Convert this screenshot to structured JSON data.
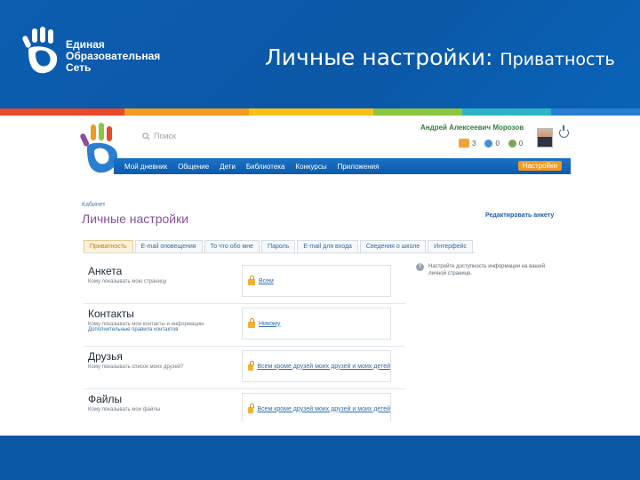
{
  "slide": {
    "title_main": "Личные настройки:",
    "title_sub": "Приватность",
    "logo_lines": [
      "Единая",
      "Образовательная",
      "Сеть"
    ]
  },
  "app": {
    "search_placeholder": "Поиск",
    "user_name": "Андрей Алексеевич Морозов",
    "counters": [
      {
        "icon": "messages-icon",
        "value": "3",
        "color": "#f2a23a"
      },
      {
        "icon": "friends-icon",
        "value": "0",
        "color": "#4a8fd4"
      },
      {
        "icon": "groups-icon",
        "value": "0",
        "color": "#7aa65a"
      }
    ],
    "nav_items": [
      "Мой дневник",
      "Общение",
      "Дети",
      "Библиотека",
      "Конкурсы",
      "Приложения"
    ],
    "nav_settings": "Настройки",
    "breadcrumb": "Кабинет",
    "page_title": "Личные настройки",
    "edit_link": "Редактировать анкету",
    "tabs": [
      {
        "label": "Приватность",
        "active": true
      },
      {
        "label": "E-mail оповещения",
        "active": false
      },
      {
        "label": "То что обо мне",
        "active": false
      },
      {
        "label": "Пароль",
        "active": false
      },
      {
        "label": "E-mail для входа",
        "active": false
      },
      {
        "label": "Сведения о школе",
        "active": false
      },
      {
        "label": "Интерфейс",
        "active": false
      }
    ],
    "settings": [
      {
        "title": "Анкета",
        "desc": "Кому показывать мою страницу",
        "link": "",
        "value": "Всем"
      },
      {
        "title": "Контакты",
        "desc": "Кому показывать мои контакты и информацию",
        "link": "Дополнительные правила контактов",
        "value": "Никому"
      },
      {
        "title": "Друзья",
        "desc": "Кому показывать список моих друзей?",
        "link": "",
        "value": "Всем кроме друзей моих друзей и моих детей"
      },
      {
        "title": "Файлы",
        "desc": "Кому показывать мои файлы",
        "link": "",
        "value": "Всем кроме друзей моих друзей и моих детей"
      }
    ],
    "hint": "Настройте доступность информации на вашей личной странице."
  },
  "colors": {
    "header_blue": "#0c5db0",
    "stripe": [
      "#e8492b",
      "#f39a23",
      "#f6c21a",
      "#8cc63f",
      "#3fae49",
      "#2fb3c8",
      "#2a7fd0"
    ],
    "nav_settings": "#f39a23",
    "title_purple": "#8a4f96"
  }
}
